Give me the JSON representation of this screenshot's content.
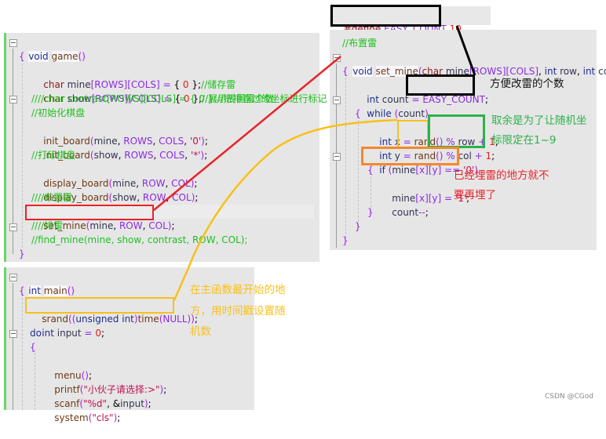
{
  "game_function": {
    "lines": [
      "void game()",
      "{",
      "char mine[ROWS][COLS] = { 0 };//储存雷",
      "char show[ROWS][COLS] = { 0 };//展示周围雷个数",
      "////char contrast[ROWS][COLS] = { 0 };//把排查过的坐标进行标记",
      "//初始化棋盘",
      "init_board(mine, ROWS, COLS, '0');",
      "init_board(show, ROWS, COLS, '*');",
      "//打印棋盘",
      "display_board(mine, ROW, COL);",
      "display_board(show, ROW, COL);",
      "////布置雷",
      "set_mine(mine, ROW, COL);",
      "////排雷",
      "//find_mine(mine, show, contrast, ROW, COL);",
      "}"
    ]
  },
  "main_function": {
    "lines": [
      "int main()",
      "{",
      "srand((unsigned int)time(NULL));",
      "int input = 0;",
      "do",
      "{",
      "menu();",
      "printf(\"小伙子请选择:>\");",
      "scanf(\"%d\", &input);",
      "system(\"cls\");"
    ]
  },
  "define_snippet": "#define EASY_COUNT 10",
  "set_mine_function": {
    "lines": [
      "//布置雷",
      "void set_mine(char mine[ROWS][COLS], int row, int col)",
      "{",
      "int count = EASY_COUNT;",
      "while (count)",
      "{",
      "int x = rand() % row + 1;",
      "int y = rand() % col + 1;",
      "if (mine[x][y] == '0')",
      "{",
      "mine[x][y] = '1';",
      "count--;",
      "}",
      "}",
      "}"
    ]
  },
  "annotations": {
    "easy_count_note": "方便改雷的个数",
    "rand_note": [
      "取余是为了让随机坐",
      "标限定在1~9"
    ],
    "if_note": [
      "已经埋雷的地方就不",
      "要再埋了"
    ],
    "srand_note": [
      "在主函数最开始的地",
      "方，用时间戳设置随",
      "机数"
    ]
  },
  "colors": {
    "red_box": "#e8232a",
    "yellow_box": "#f9c01a",
    "green_box": "#2db14a",
    "orange_box": "#f5882a",
    "black_box": "#000000",
    "note_black": "#111111",
    "note_green": "#2db14a",
    "note_red": "#e8232a",
    "note_yellow": "#f9c01a"
  },
  "watermark": "CSDN @CGod"
}
